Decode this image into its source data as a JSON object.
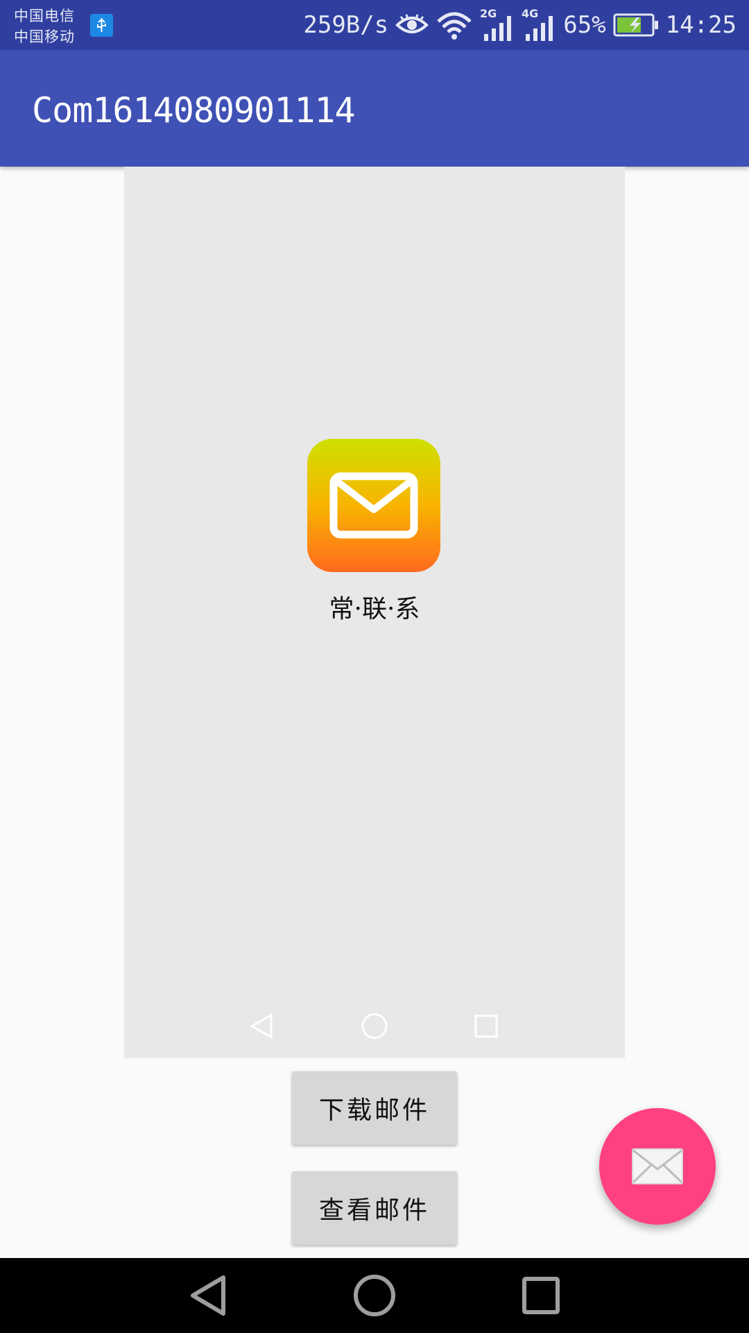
{
  "status_bar": {
    "carrier_1": "中国电信",
    "carrier_2": "中国移动",
    "net_speed": "259B/s",
    "signal_1_label": "2G",
    "signal_2_label": "4G",
    "battery": "65%",
    "time": "14:25",
    "icons": [
      "usb-icon",
      "eye-icon",
      "wifi-icon",
      "signal-2g-icon",
      "signal-4g-icon",
      "battery-charging-icon"
    ]
  },
  "app_bar": {
    "title": "Com1614080901114"
  },
  "preview": {
    "logo_icon": "envelope-icon",
    "logo_text": "常·联·系",
    "nav_icons": [
      "back-icon",
      "home-icon",
      "recents-icon"
    ]
  },
  "buttons": {
    "download_label": "下载邮件",
    "view_label": "查看邮件"
  },
  "fab": {
    "icon": "mail-icon"
  },
  "colors": {
    "status_bar": "#303f9f",
    "app_bar": "#3f51b5",
    "fab": "#ff4081",
    "logo_gradient": [
      "#cfe000",
      "#f8b400",
      "#ff6a1f"
    ],
    "button": "#d6d7d7"
  }
}
